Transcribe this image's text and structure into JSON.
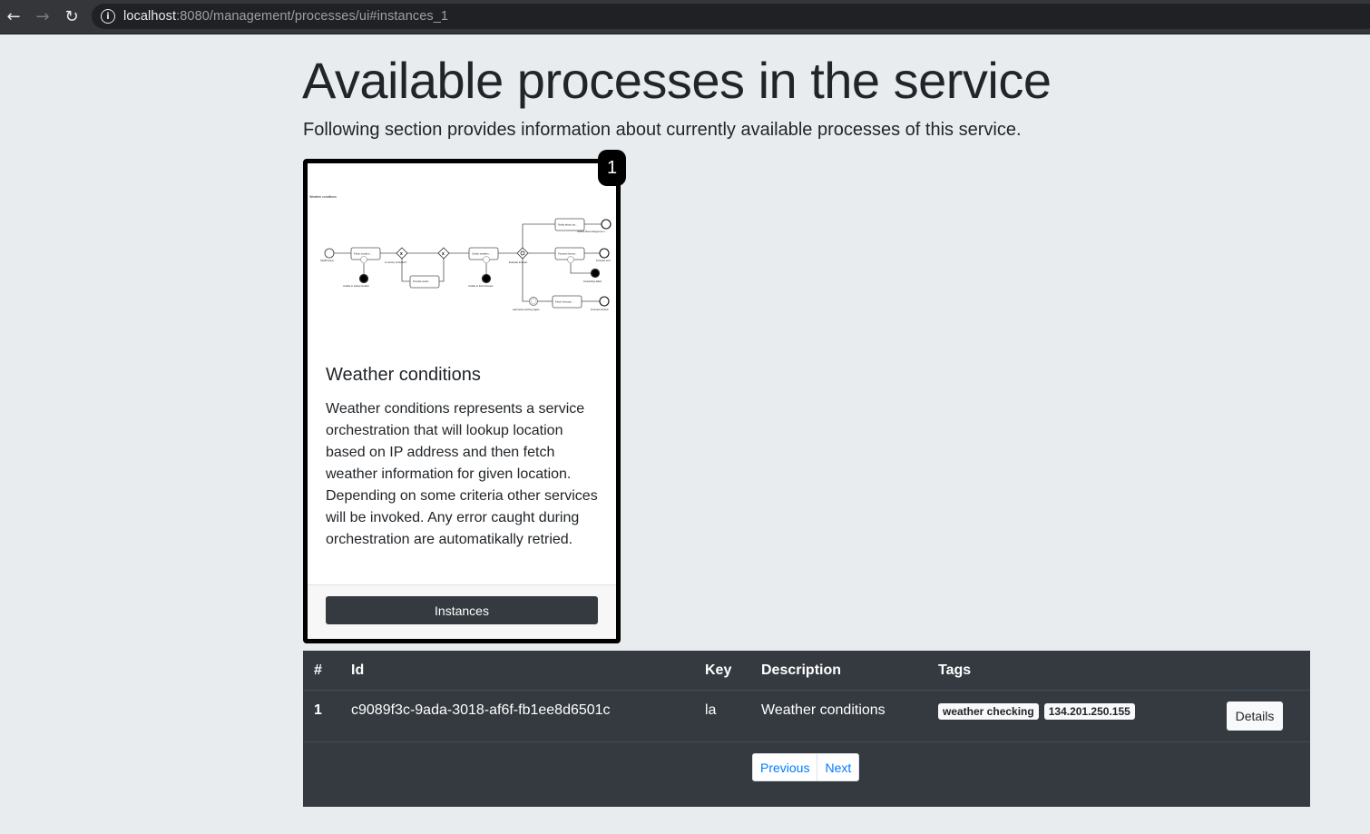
{
  "browser": {
    "back_icon": "arrow-left-icon",
    "forward_icon": "arrow-right-icon",
    "reload_icon": "reload-icon",
    "info_icon": "info-icon",
    "url_host": "localhost",
    "url_rest": ":8080/management/processes/ui#instances_1"
  },
  "page": {
    "title": "Available processes in the service",
    "lead": "Following section provides information about currently available processes of this service."
  },
  "process_card": {
    "badge": "1",
    "title": "Weather conditions",
    "description": "Weather conditions represents a service orchestration that will lookup location based on IP address and then fetch weather information for given location. Depending on some criteria other services will be invoked. Any error caught during orchestration are automatikally retried.",
    "instances_label": "Instances",
    "diagram": {
      "title": "Weather conditions",
      "labels": {
        "start": "StartProcess",
        "fetch_location": "Fetch location ...",
        "unable_lookup": "Unable to lookup location",
        "country_excluded": "Is country excluded?",
        "provide_location": "Provide locati...",
        "check_weather": "Check weather ...",
        "unable_fetch": "Unable to fetch forecast",
        "evaluate": "Evaluate forecast",
        "notify": "Notify about da...",
        "notified": "notified about dangerous c...",
        "forward": "Forward foreca...",
        "forecast_sent": "Forecast sent",
        "forwarding_failed": "Forwarding failed",
        "wait": "wait before fetching again",
        "fetch_forecast": "Fetch forecast ...",
        "forecast_fetched": "Forecast fetched"
      }
    }
  },
  "instances_table": {
    "columns": [
      "#",
      "Id",
      "Key",
      "Description",
      "Tags"
    ],
    "rows": [
      {
        "num": "1",
        "id": "c9089f3c-9ada-3018-af6f-fb1ee8d6501c",
        "key": "la",
        "description": "Weather conditions",
        "tags": [
          "weather checking",
          "134.201.250.155"
        ],
        "action": "Details"
      }
    ],
    "pagination": {
      "previous": "Previous",
      "next": "Next"
    }
  }
}
